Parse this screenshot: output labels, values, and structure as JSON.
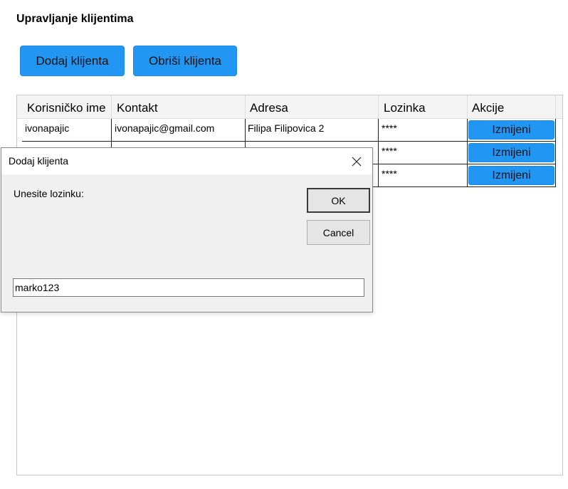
{
  "page": {
    "title": "Upravljanje klijentima"
  },
  "toolbar": {
    "add_label": "Dodaj klijenta",
    "delete_label": "Obriši klijenta"
  },
  "table": {
    "columns": [
      "Korisničko ime",
      "Kontakt",
      "Adresa",
      "Lozinka",
      "Akcije"
    ],
    "rows": [
      {
        "username": "ivonapajic",
        "contact": "ivonapajic@gmail.com",
        "address": "Filipa Filipovica 2",
        "password": "****",
        "action": "Izmijeni"
      },
      {
        "username": "",
        "contact": "",
        "address": "",
        "password": "****",
        "action": "Izmijeni"
      },
      {
        "username": "",
        "contact": "",
        "address": "",
        "password": "****",
        "action": "Izmijeni"
      }
    ]
  },
  "dialog": {
    "title": "Dodaj klijenta",
    "prompt": "Unesite lozinku:",
    "ok_label": "OK",
    "cancel_label": "Cancel",
    "input_value": "marko123"
  },
  "colors": {
    "accent": "#2196f3",
    "dialog_bg": "#f0f0f0"
  }
}
